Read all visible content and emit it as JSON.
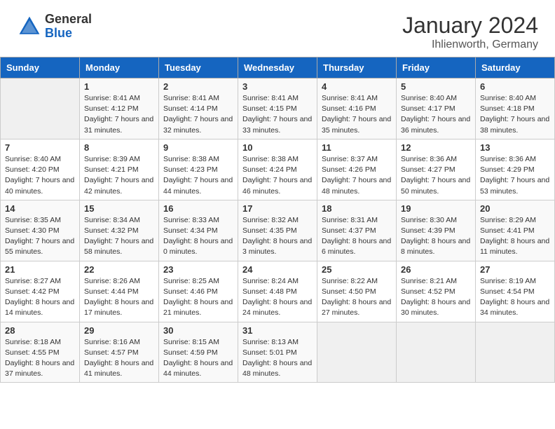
{
  "header": {
    "logo_general": "General",
    "logo_blue": "Blue",
    "title": "January 2024",
    "subtitle": "Ihlienworth, Germany"
  },
  "days_of_week": [
    "Sunday",
    "Monday",
    "Tuesday",
    "Wednesday",
    "Thursday",
    "Friday",
    "Saturday"
  ],
  "weeks": [
    [
      {
        "day": "",
        "sunrise": "",
        "sunset": "",
        "daylight": ""
      },
      {
        "day": "1",
        "sunrise": "Sunrise: 8:41 AM",
        "sunset": "Sunset: 4:12 PM",
        "daylight": "Daylight: 7 hours and 31 minutes."
      },
      {
        "day": "2",
        "sunrise": "Sunrise: 8:41 AM",
        "sunset": "Sunset: 4:14 PM",
        "daylight": "Daylight: 7 hours and 32 minutes."
      },
      {
        "day": "3",
        "sunrise": "Sunrise: 8:41 AM",
        "sunset": "Sunset: 4:15 PM",
        "daylight": "Daylight: 7 hours and 33 minutes."
      },
      {
        "day": "4",
        "sunrise": "Sunrise: 8:41 AM",
        "sunset": "Sunset: 4:16 PM",
        "daylight": "Daylight: 7 hours and 35 minutes."
      },
      {
        "day": "5",
        "sunrise": "Sunrise: 8:40 AM",
        "sunset": "Sunset: 4:17 PM",
        "daylight": "Daylight: 7 hours and 36 minutes."
      },
      {
        "day": "6",
        "sunrise": "Sunrise: 8:40 AM",
        "sunset": "Sunset: 4:18 PM",
        "daylight": "Daylight: 7 hours and 38 minutes."
      }
    ],
    [
      {
        "day": "7",
        "sunrise": "Sunrise: 8:40 AM",
        "sunset": "Sunset: 4:20 PM",
        "daylight": "Daylight: 7 hours and 40 minutes."
      },
      {
        "day": "8",
        "sunrise": "Sunrise: 8:39 AM",
        "sunset": "Sunset: 4:21 PM",
        "daylight": "Daylight: 7 hours and 42 minutes."
      },
      {
        "day": "9",
        "sunrise": "Sunrise: 8:38 AM",
        "sunset": "Sunset: 4:23 PM",
        "daylight": "Daylight: 7 hours and 44 minutes."
      },
      {
        "day": "10",
        "sunrise": "Sunrise: 8:38 AM",
        "sunset": "Sunset: 4:24 PM",
        "daylight": "Daylight: 7 hours and 46 minutes."
      },
      {
        "day": "11",
        "sunrise": "Sunrise: 8:37 AM",
        "sunset": "Sunset: 4:26 PM",
        "daylight": "Daylight: 7 hours and 48 minutes."
      },
      {
        "day": "12",
        "sunrise": "Sunrise: 8:36 AM",
        "sunset": "Sunset: 4:27 PM",
        "daylight": "Daylight: 7 hours and 50 minutes."
      },
      {
        "day": "13",
        "sunrise": "Sunrise: 8:36 AM",
        "sunset": "Sunset: 4:29 PM",
        "daylight": "Daylight: 7 hours and 53 minutes."
      }
    ],
    [
      {
        "day": "14",
        "sunrise": "Sunrise: 8:35 AM",
        "sunset": "Sunset: 4:30 PM",
        "daylight": "Daylight: 7 hours and 55 minutes."
      },
      {
        "day": "15",
        "sunrise": "Sunrise: 8:34 AM",
        "sunset": "Sunset: 4:32 PM",
        "daylight": "Daylight: 7 hours and 58 minutes."
      },
      {
        "day": "16",
        "sunrise": "Sunrise: 8:33 AM",
        "sunset": "Sunset: 4:34 PM",
        "daylight": "Daylight: 8 hours and 0 minutes."
      },
      {
        "day": "17",
        "sunrise": "Sunrise: 8:32 AM",
        "sunset": "Sunset: 4:35 PM",
        "daylight": "Daylight: 8 hours and 3 minutes."
      },
      {
        "day": "18",
        "sunrise": "Sunrise: 8:31 AM",
        "sunset": "Sunset: 4:37 PM",
        "daylight": "Daylight: 8 hours and 6 minutes."
      },
      {
        "day": "19",
        "sunrise": "Sunrise: 8:30 AM",
        "sunset": "Sunset: 4:39 PM",
        "daylight": "Daylight: 8 hours and 8 minutes."
      },
      {
        "day": "20",
        "sunrise": "Sunrise: 8:29 AM",
        "sunset": "Sunset: 4:41 PM",
        "daylight": "Daylight: 8 hours and 11 minutes."
      }
    ],
    [
      {
        "day": "21",
        "sunrise": "Sunrise: 8:27 AM",
        "sunset": "Sunset: 4:42 PM",
        "daylight": "Daylight: 8 hours and 14 minutes."
      },
      {
        "day": "22",
        "sunrise": "Sunrise: 8:26 AM",
        "sunset": "Sunset: 4:44 PM",
        "daylight": "Daylight: 8 hours and 17 minutes."
      },
      {
        "day": "23",
        "sunrise": "Sunrise: 8:25 AM",
        "sunset": "Sunset: 4:46 PM",
        "daylight": "Daylight: 8 hours and 21 minutes."
      },
      {
        "day": "24",
        "sunrise": "Sunrise: 8:24 AM",
        "sunset": "Sunset: 4:48 PM",
        "daylight": "Daylight: 8 hours and 24 minutes."
      },
      {
        "day": "25",
        "sunrise": "Sunrise: 8:22 AM",
        "sunset": "Sunset: 4:50 PM",
        "daylight": "Daylight: 8 hours and 27 minutes."
      },
      {
        "day": "26",
        "sunrise": "Sunrise: 8:21 AM",
        "sunset": "Sunset: 4:52 PM",
        "daylight": "Daylight: 8 hours and 30 minutes."
      },
      {
        "day": "27",
        "sunrise": "Sunrise: 8:19 AM",
        "sunset": "Sunset: 4:54 PM",
        "daylight": "Daylight: 8 hours and 34 minutes."
      }
    ],
    [
      {
        "day": "28",
        "sunrise": "Sunrise: 8:18 AM",
        "sunset": "Sunset: 4:55 PM",
        "daylight": "Daylight: 8 hours and 37 minutes."
      },
      {
        "day": "29",
        "sunrise": "Sunrise: 8:16 AM",
        "sunset": "Sunset: 4:57 PM",
        "daylight": "Daylight: 8 hours and 41 minutes."
      },
      {
        "day": "30",
        "sunrise": "Sunrise: 8:15 AM",
        "sunset": "Sunset: 4:59 PM",
        "daylight": "Daylight: 8 hours and 44 minutes."
      },
      {
        "day": "31",
        "sunrise": "Sunrise: 8:13 AM",
        "sunset": "Sunset: 5:01 PM",
        "daylight": "Daylight: 8 hours and 48 minutes."
      },
      {
        "day": "",
        "sunrise": "",
        "sunset": "",
        "daylight": ""
      },
      {
        "day": "",
        "sunrise": "",
        "sunset": "",
        "daylight": ""
      },
      {
        "day": "",
        "sunrise": "",
        "sunset": "",
        "daylight": ""
      }
    ]
  ]
}
